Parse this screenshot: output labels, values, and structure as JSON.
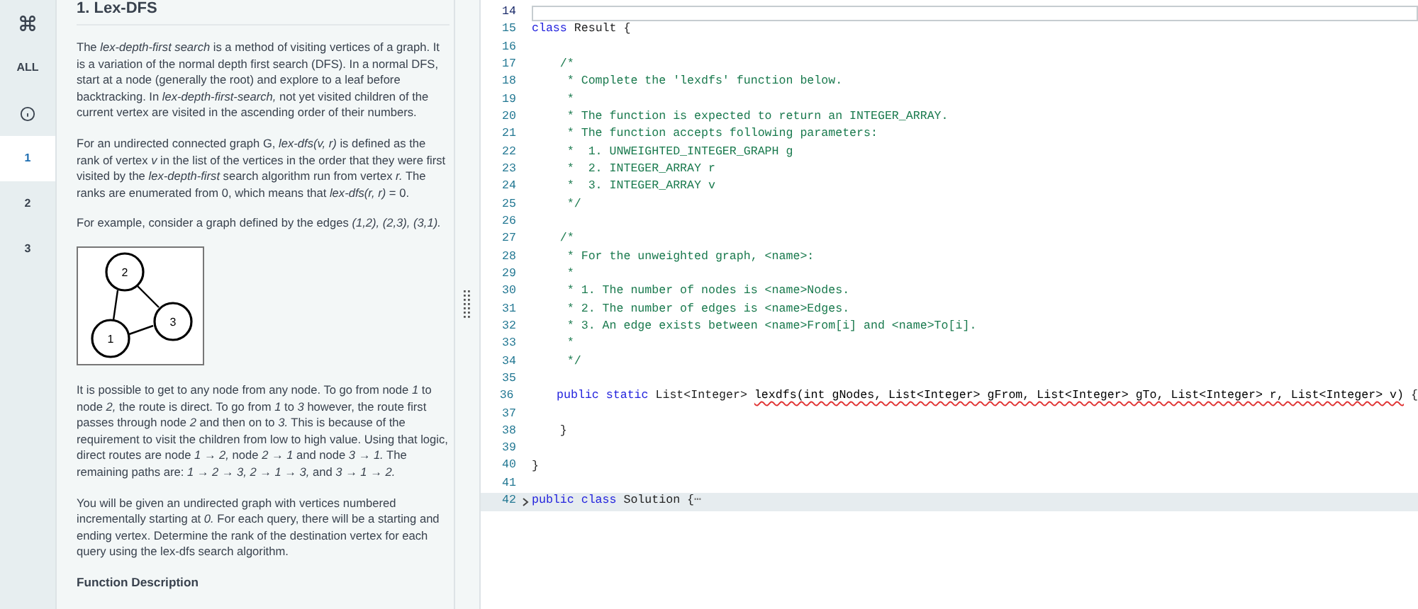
{
  "rail": {
    "items": [
      {
        "kind": "command-icon",
        "selected": false
      },
      {
        "kind": "text",
        "label": "ALL",
        "selected": false
      },
      {
        "kind": "info-icon",
        "selected": false
      },
      {
        "kind": "text",
        "label": "1",
        "selected": true
      },
      {
        "kind": "text",
        "label": "2",
        "selected": false
      },
      {
        "kind": "text",
        "label": "3",
        "selected": false
      }
    ]
  },
  "problem": {
    "title": "1. Lex-DFS",
    "paragraphs": [
      "The *lex-depth-first search* is a method of visiting vertices of a graph. It is a variation of the normal depth first search (DFS). In a normal DFS, start at a node (generally the root) and explore to a leaf before backtracking. In *lex-depth-first-search,* not yet visited children of the current vertex are visited in the ascending order of their numbers.",
      "For an undirected connected graph G, *lex-dfs(v, r)* is defined as the rank of vertex *v* in the list of the vertices in the order that they were first visited by the *lex-depth-first* search algorithm run from vertex *r.* The ranks are enumerated from 0, which means that *lex-dfs(r, r)* = 0.",
      "For example, consider a graph defined by the edges *(1,2), (2,3), (3,1).*"
    ],
    "graph": {
      "nodes": [
        "2",
        "3",
        "1"
      ]
    },
    "paragraphs_after": [
      "It is possible to get to any node from any node. To go from node *1* to node *2,* the route is direct. To go from *1* to *3* however, the route first passes through node *2* and then on to *3.* This is because of the requirement to visit the children from low to high value. Using that logic, direct routes are node *1 → 2,* node *2 → 1* and node *3 → 1.* The remaining paths are: *1 → 2 → 3, 2 → 1 → 3,* and *3 → 1 → 2.*",
      "You will be given an undirected graph with vertices numbered incrementally starting at *0.* For each query, there will be a starting and ending vertex. Determine the rank of the destination vertex for each query using the lex-dfs search algorithm."
    ],
    "section_heading": "Function Description"
  },
  "editor": {
    "lines": [
      {
        "number": "14",
        "active": true,
        "folded": false
      },
      {
        "number": "15",
        "active": false,
        "folded": false,
        "tokens": [
          {
            "kind": "keyword",
            "text": "class"
          },
          {
            "kind": "plain",
            "text": " Result {"
          }
        ]
      },
      {
        "number": "16",
        "active": false,
        "folded": false
      },
      {
        "number": "17",
        "active": false,
        "folded": false,
        "tokens": [
          {
            "kind": "comment",
            "text": "    /*"
          }
        ]
      },
      {
        "number": "18",
        "active": false,
        "folded": false,
        "tokens": [
          {
            "kind": "comment",
            "text": "     * Complete the 'lexdfs' function below."
          }
        ]
      },
      {
        "number": "19",
        "active": false,
        "folded": false,
        "tokens": [
          {
            "kind": "comment",
            "text": "     *"
          }
        ]
      },
      {
        "number": "20",
        "active": false,
        "folded": false,
        "tokens": [
          {
            "kind": "comment",
            "text": "     * The function is expected to return an INTEGER_ARRAY."
          }
        ]
      },
      {
        "number": "21",
        "active": false,
        "folded": false,
        "tokens": [
          {
            "kind": "comment",
            "text": "     * The function accepts following parameters:"
          }
        ]
      },
      {
        "number": "22",
        "active": false,
        "folded": false,
        "tokens": [
          {
            "kind": "comment",
            "text": "     *  1. UNWEIGHTED_INTEGER_GRAPH g"
          }
        ]
      },
      {
        "number": "23",
        "active": false,
        "folded": false,
        "tokens": [
          {
            "kind": "comment",
            "text": "     *  2. INTEGER_ARRAY r"
          }
        ]
      },
      {
        "number": "24",
        "active": false,
        "folded": false,
        "tokens": [
          {
            "kind": "comment",
            "text": "     *  3. INTEGER_ARRAY v"
          }
        ]
      },
      {
        "number": "25",
        "active": false,
        "folded": false,
        "tokens": [
          {
            "kind": "comment",
            "text": "     */"
          }
        ]
      },
      {
        "number": "26",
        "active": false,
        "folded": false
      },
      {
        "number": "27",
        "active": false,
        "folded": false,
        "tokens": [
          {
            "kind": "comment",
            "text": "    /*"
          }
        ]
      },
      {
        "number": "28",
        "active": false,
        "folded": false,
        "tokens": [
          {
            "kind": "comment",
            "text": "     * For the unweighted graph, <name>:"
          }
        ]
      },
      {
        "number": "29",
        "active": false,
        "folded": false,
        "tokens": [
          {
            "kind": "comment",
            "text": "     *"
          }
        ]
      },
      {
        "number": "30",
        "active": false,
        "folded": false,
        "tokens": [
          {
            "kind": "comment",
            "text": "     * 1. The number of nodes is <name>Nodes."
          }
        ]
      },
      {
        "number": "31",
        "active": false,
        "folded": false,
        "tokens": [
          {
            "kind": "comment",
            "text": "     * 2. The number of edges is <name>Edges."
          }
        ]
      },
      {
        "number": "32",
        "active": false,
        "folded": false,
        "tokens": [
          {
            "kind": "comment",
            "text": "     * 3. An edge exists between <name>From[i] and <name>To[i]."
          }
        ]
      },
      {
        "number": "33",
        "active": false,
        "folded": false,
        "tokens": [
          {
            "kind": "comment",
            "text": "     *"
          }
        ]
      },
      {
        "number": "34",
        "active": false,
        "folded": false,
        "tokens": [
          {
            "kind": "comment",
            "text": "     */"
          }
        ]
      },
      {
        "number": "35",
        "active": false,
        "folded": false
      },
      {
        "number": "36",
        "active": false,
        "folded": false,
        "tokens": [
          {
            "kind": "keyword",
            "text": "    public static"
          },
          {
            "kind": "plain",
            "text": " List<Integer> "
          },
          {
            "kind": "error",
            "text": "lexdfs(int gNodes, List<Integer> gFrom, List<Integer> gTo, List<Integer> r, List<Integer> v)"
          },
          {
            "kind": "plain",
            "text": " {"
          }
        ]
      },
      {
        "number": "37",
        "active": false,
        "folded": false
      },
      {
        "number": "38",
        "active": false,
        "folded": false,
        "tokens": [
          {
            "kind": "plain",
            "text": "    }"
          }
        ]
      },
      {
        "number": "39",
        "active": false,
        "folded": false
      },
      {
        "number": "40",
        "active": false,
        "folded": false,
        "tokens": [
          {
            "kind": "plain",
            "text": "}"
          }
        ]
      },
      {
        "number": "41",
        "active": false,
        "folded": false
      },
      {
        "number": "42",
        "active": false,
        "folded": true,
        "fold_marker": "⋯",
        "tokens": [
          {
            "kind": "keyword",
            "text": "public class"
          },
          {
            "kind": "plain",
            "text": " Solution {"
          }
        ]
      }
    ]
  }
}
